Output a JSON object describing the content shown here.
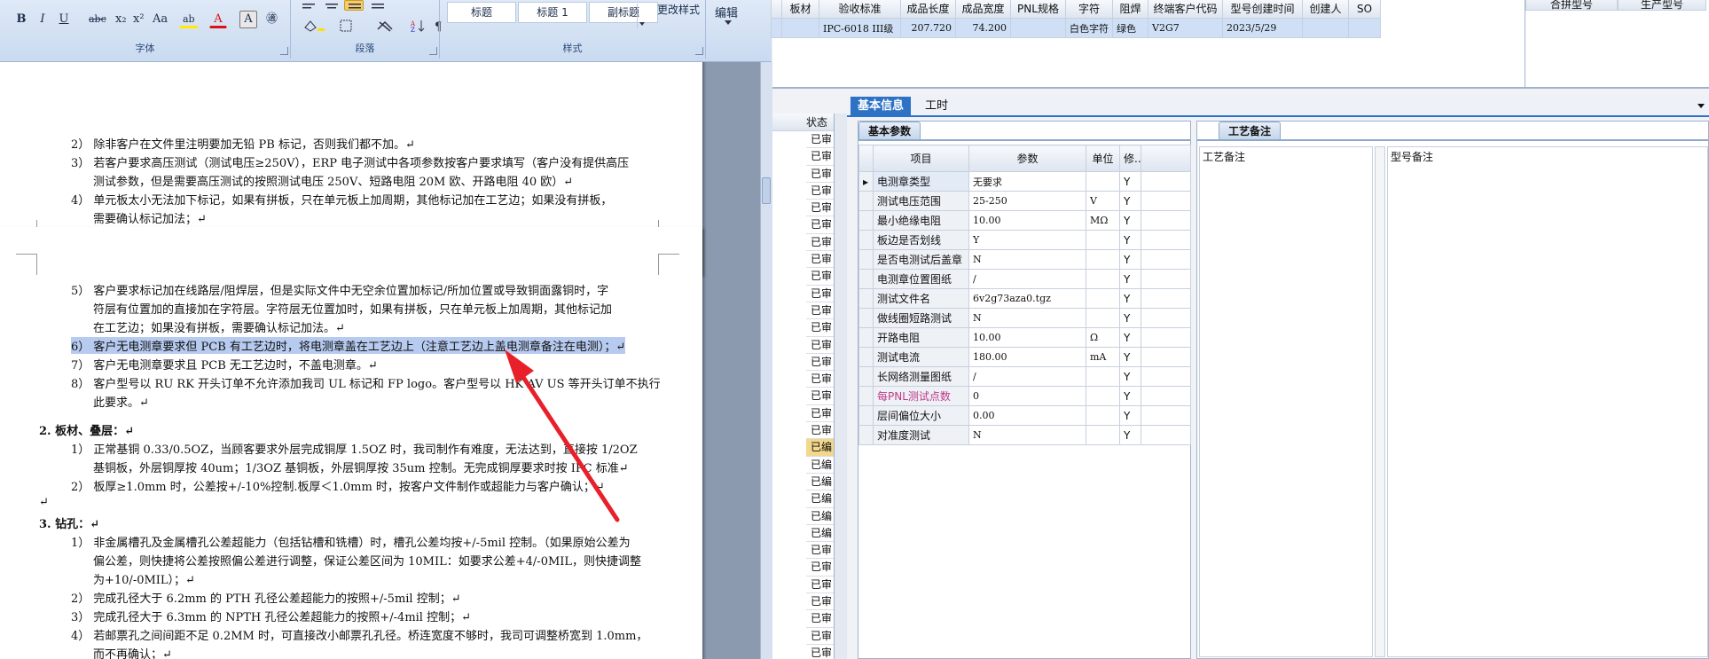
{
  "ribbon": {
    "groups": [
      {
        "label": "字体"
      },
      {
        "label": "段落"
      },
      {
        "label": "样式"
      },
      {
        "label": ""
      }
    ],
    "font_buttons": [
      "B",
      "I",
      "U",
      "abc",
      "x₂",
      "x²",
      "Aa",
      "ab",
      "A",
      "A",
      "㊜"
    ],
    "styles": [
      "标题",
      "标题 1",
      "副标题"
    ],
    "change_styles": "更改样式",
    "edit": "编辑"
  },
  "doc": {
    "page1": [
      "2） 除非客户在文件里注明要加无铅 PB 标记，否则我们都不加。↵",
      "3） 若客户要求高压测试（测试电压≥250V），ERP 电子测试中各项参数按客户要求填写（客户没有提供高压",
      "测试参数，但是需要高压测试的按照测试电压 250V、短路电阻 20M 欧、开路电阻 40 欧）↵",
      "4） 单元板太小无法加下标记，如果有拼板，只在单元板上加周期，其他标记加在工艺边；如果没有拼板，",
      "需要确认标记加法；↵"
    ],
    "page2": [
      "5） 客户要求标记加在线路层/阻焊层，但是实际文件中无空余位置加标记/所加位置或导致铜面露铜时，字",
      "符层有位置加的直接加在字符层。字符层无位置加时，如果有拼板，只在单元板上加周期，其他标记加",
      "在工艺边；如果没有拼板，需要确认标记加法。↵",
      "6） 客户无电测章要求但 PCB 有工艺边时，将电测章盖在工艺边上（注意工艺边上盖电测章备注在电测）；↵",
      "7） 客户无电测章要求且 PCB 无工艺边时，不盖电测章。↵",
      "8） 客户型号以 RU RK 开头订单不允许添加我司 UL 标记和 FP logo。客户型号以 HK AV US 等开头订单不执行",
      "此要求。↵",
      "2.   板材、叠层：↵",
      "1） 正常基铜 0.33/0.5OZ，当顾客要求外层完成铜厚 1.5OZ 时，我司制作有难度，无法达到，直接按 1/2OZ",
      "基铜板，外层铜厚按 40um；1/3OZ 基铜板，外层铜厚按 35um 控制。无完成铜厚要求时按 IPC 标准↵",
      "2） 板厚≥1.0mm 时，公差按+/-10%控制.板厚＜1.0mm 时，按客户文件制作或超能力与客户确认；↵",
      "↵",
      "3.   钻孔：↵",
      "1） 非金属槽孔及金属槽孔公差超能力（包括钻槽和铣槽）时，槽孔公差均按+/-5mil 控制。（如果原始公差为",
      "偏公差，则快捷将公差按照偏公差进行调整，保证公差区间为 10MIL：如要求公差+4/-0MIL，则快捷调整",
      "为+10/-0MIL）；↵",
      "2） 完成孔径大于 6.2mm 的 PTH 孔径公差超能力的按照+/-5mil 控制；↵",
      "3） 完成孔径大于 6.3mm 的 NPTH 孔径公差超能力的按照+/-4mil 控制；↵",
      "4） 若邮票孔之间间距不足 0.2MM 时，可直接改小邮票孔孔径。桥连宽度不够时，我司可调整桥宽到 1.0mm，",
      "而不再确认；↵"
    ]
  },
  "top_grid": {
    "headers": [
      "板材",
      "验收标准",
      "成品长度",
      "成品宽度",
      "PNL规格",
      "字符",
      "阻焊",
      "终端客户代码",
      "型号创建时间",
      "创建人",
      "SO"
    ],
    "row": [
      "",
      "IPC-6018 III级",
      "207.720",
      "74.200",
      "",
      "白色字符",
      "绿色",
      "V2G7",
      "2023/5/29",
      "",
      ""
    ],
    "right_headers": [
      "合拼型号",
      "生产型号"
    ]
  },
  "status": {
    "header": "状态",
    "cells": [
      "已审",
      "已审",
      "已审",
      "已审",
      "已审",
      "已审",
      "已审",
      "已审",
      "已审",
      "已审",
      "已审",
      "已审",
      "已审",
      "已审",
      "已审",
      "已审",
      "已审",
      "已审",
      "已编",
      "已编",
      "已编",
      "已编",
      "已编",
      "已编",
      "已审",
      "已审",
      "已审",
      "已审",
      "已审",
      "已审",
      "已审"
    ]
  },
  "tabs": {
    "basic": "基本信息",
    "work": "工时"
  },
  "params": {
    "subtab": "基本参数",
    "headers": [
      "项目",
      "参数",
      "单位",
      "修..."
    ],
    "rows": [
      {
        "item": "电测章类型",
        "value": "无要求",
        "unit": "",
        "flag": "Y"
      },
      {
        "item": "测试电压范围",
        "value": "25-250",
        "unit": "V",
        "flag": "Y"
      },
      {
        "item": "最小绝缘电阻",
        "value": "10.00",
        "unit": "MΩ",
        "flag": "Y"
      },
      {
        "item": "板边是否划线",
        "value": "Y",
        "unit": "",
        "flag": "Y"
      },
      {
        "item": "是否电测试后盖章",
        "value": "N",
        "unit": "",
        "flag": "Y"
      },
      {
        "item": "电测章位置图纸",
        "value": "/",
        "unit": "",
        "flag": "Y"
      },
      {
        "item": "测试文件名",
        "value": "6v2g73aza0.tgz",
        "unit": "",
        "flag": "Y"
      },
      {
        "item": "做线圈短路测试",
        "value": "N",
        "unit": "",
        "flag": "Y"
      },
      {
        "item": "开路电阻",
        "value": "10.00",
        "unit": "Ω",
        "flag": "Y"
      },
      {
        "item": "测试电流",
        "value": "180.00",
        "unit": "mA",
        "flag": "Y"
      },
      {
        "item": "长网络测量图纸",
        "value": "/",
        "unit": "",
        "flag": "Y"
      },
      {
        "item": "每PNL测试点数",
        "value": "0",
        "unit": "",
        "flag": "Y"
      },
      {
        "item": "层间偏位大小",
        "value": "0.00",
        "unit": "",
        "flag": "Y"
      },
      {
        "item": "对准度测试",
        "value": "N",
        "unit": "",
        "flag": "Y"
      }
    ]
  },
  "notes": {
    "subtab": "工艺备注",
    "craft": "工艺备注",
    "model": "型号备注"
  },
  "colors": {
    "accent": "#2d72c4",
    "arrow": "#e8202a",
    "highlight": "#b7cbf0",
    "pink": "#c03a8a"
  }
}
